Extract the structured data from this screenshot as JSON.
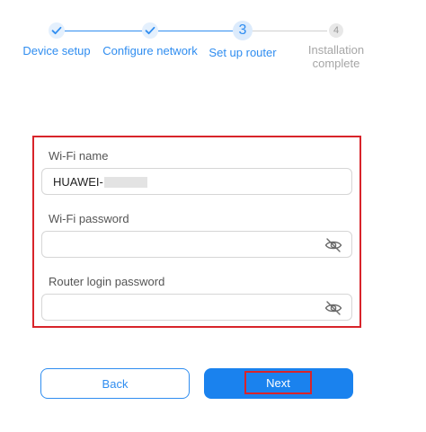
{
  "stepper": {
    "steps": [
      {
        "label": "Device setup",
        "state": "done"
      },
      {
        "label": "Configure network",
        "state": "done"
      },
      {
        "number": "3",
        "label": "Set up router",
        "state": "active"
      },
      {
        "number": "4",
        "label": "Installation complete",
        "state": "todo"
      }
    ]
  },
  "form": {
    "wifi_name": {
      "label": "Wi-Fi name",
      "value": "HUAWEI-"
    },
    "wifi_password": {
      "label": "Wi-Fi password",
      "value": ""
    },
    "router_password": {
      "label": "Router login password",
      "value": ""
    }
  },
  "buttons": {
    "back": "Back",
    "next": "Next"
  },
  "colors": {
    "accent": "#2f8df0",
    "primary_button": "#1a82ee",
    "highlight": "#d8242a"
  },
  "icons": {
    "step_done": "check-icon",
    "password_toggle": "eye-off-icon"
  }
}
